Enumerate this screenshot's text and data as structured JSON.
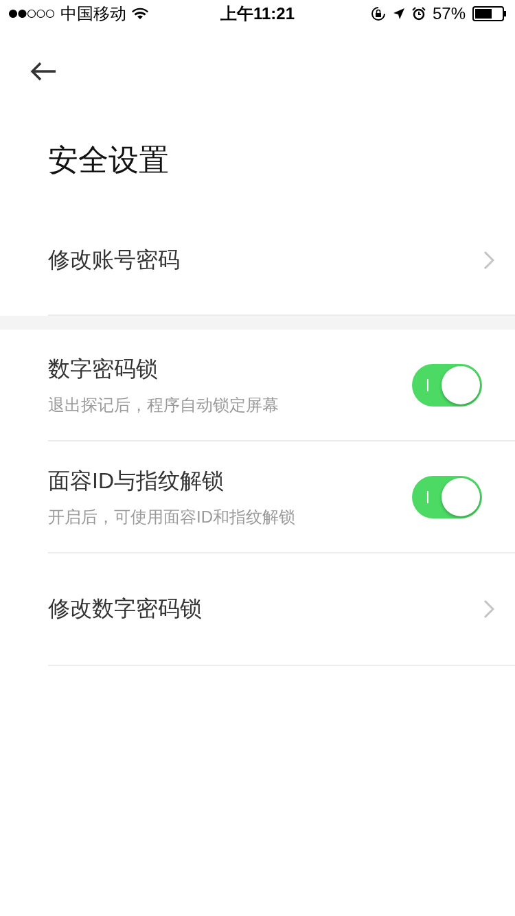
{
  "status_bar": {
    "carrier": "中国移动",
    "time": "上午11:21",
    "battery": "57%"
  },
  "title": "安全设置",
  "sections": [
    [
      {
        "kind": "link",
        "label": "修改账号密码"
      }
    ],
    [
      {
        "kind": "toggle",
        "label": "数字密码锁",
        "description": "退出探记后，程序自动锁定屏幕",
        "on": true
      },
      {
        "kind": "toggle",
        "label": "面容ID与指纹解锁",
        "description": "开启后，可使用面容ID和指纹解锁",
        "on": true
      },
      {
        "kind": "link",
        "label": "修改数字密码锁"
      }
    ]
  ]
}
